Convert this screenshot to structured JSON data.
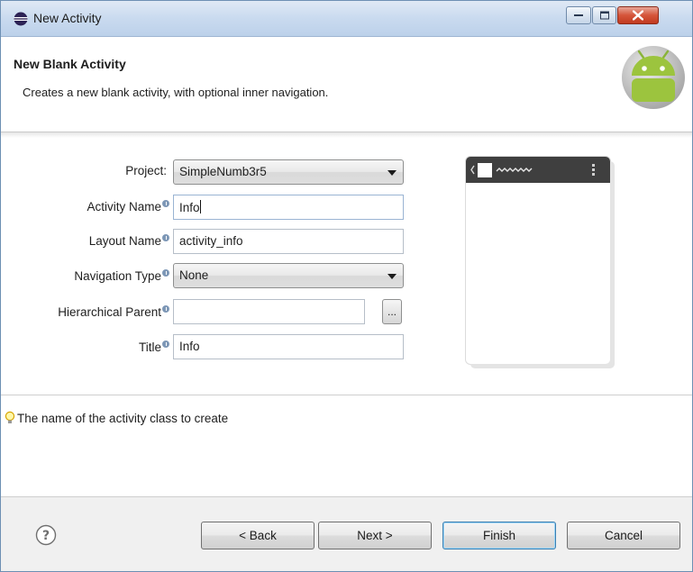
{
  "window": {
    "title": "New Activity"
  },
  "header": {
    "title": "New Blank Activity",
    "description": "Creates a new blank activity, with optional inner navigation."
  },
  "form": {
    "project": {
      "label": "Project:",
      "value": "SimpleNumb3r5"
    },
    "activity_name": {
      "label": "Activity Name",
      "value": "Info"
    },
    "layout_name": {
      "label": "Layout Name",
      "value": "activity_info"
    },
    "navigation_type": {
      "label": "Navigation Type",
      "value": "None"
    },
    "hierarchical_parent": {
      "label": "Hierarchical Parent",
      "value": "",
      "browse_label": "..."
    },
    "title": {
      "label": "Title",
      "value": "Info"
    }
  },
  "hint": {
    "text": "The name of the activity class to create"
  },
  "buttons": {
    "back": "< Back",
    "next": "Next >",
    "finish": "Finish",
    "cancel": "Cancel"
  },
  "icons": {
    "app": "eclipse-icon",
    "logo": "android-logo",
    "info": "info-icon",
    "hint": "lightbulb-icon",
    "help": "help-icon"
  },
  "colors": {
    "titlebar": "#c9daef",
    "preview_bar": "#3f3f3f",
    "android_green": "#a4c639",
    "close_button": "#c13a1f"
  }
}
